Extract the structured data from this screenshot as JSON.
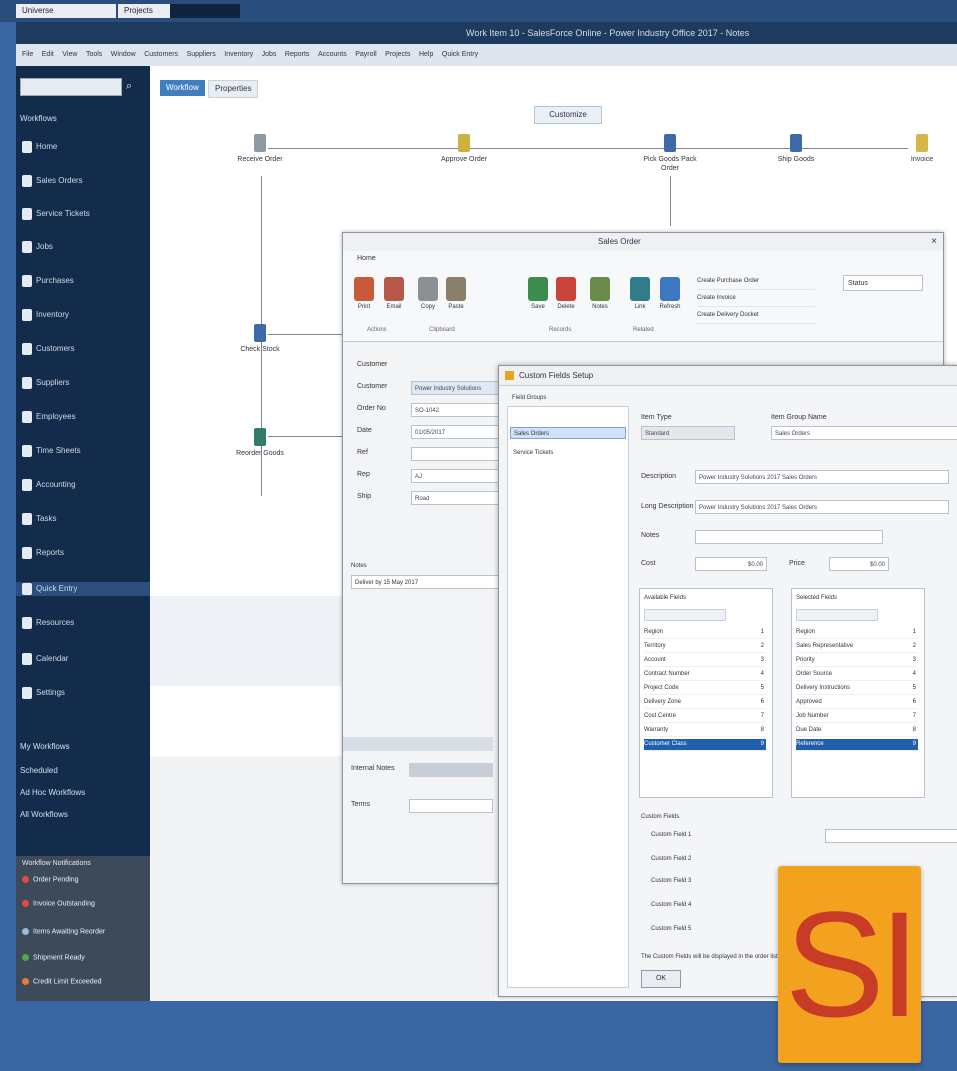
{
  "taskbar": {
    "tabs": [
      "Universe",
      "Projects"
    ]
  },
  "window": {
    "title": "Work Item 10 - SalesForce Online - Power Industry Office 2017 - Notes"
  },
  "menu": [
    "File",
    "Edit",
    "View",
    "Tools",
    "Window",
    "Customers",
    "Suppliers",
    "Inventory",
    "Jobs",
    "Reports",
    "Accounts",
    "Payroll",
    "Projects",
    "Help",
    "Quick Entry"
  ],
  "sidebar": {
    "section": "Workflows",
    "items": [
      "Home",
      "Sales Orders",
      "Service Tickets",
      "Jobs",
      "Purchases",
      "Inventory",
      "Customers",
      "Suppliers",
      "Employees",
      "Time Sheets",
      "Accounting",
      "Tasks",
      "Reports",
      "Quick Entry",
      "Resources",
      "Calendar",
      "Settings"
    ],
    "groups": [
      "My Workflows",
      "Scheduled",
      "Ad Hoc Workflows",
      "All Workflows"
    ],
    "panel2": {
      "header": "Workflow Notifications",
      "items": [
        {
          "label": "Order Pending",
          "color": "#e24a3b"
        },
        {
          "label": "Invoice Outstanding",
          "color": "#e24a3b"
        },
        {
          "label": "Items Awaiting Reorder",
          "color": "#9fb9d6"
        },
        {
          "label": "Shipment Ready",
          "color": "#53a84a"
        },
        {
          "label": "Credit Limit Exceeded",
          "color": "#e27d3b"
        }
      ]
    }
  },
  "main": {
    "tabs": [
      "Workflow",
      "Properties"
    ],
    "center_button": "Customize",
    "nodes": [
      {
        "label": "Receive Order",
        "color": "#8e98a3"
      },
      {
        "label": "Approve Order",
        "color": "#c9b23e"
      },
      {
        "label": "Pick Goods Pack Order",
        "color": "#3e6aa8"
      },
      {
        "label": "Ship Goods",
        "color": "#3e6aa8"
      },
      {
        "label": "Invoice",
        "color": "#d4b64a"
      },
      {
        "label": "Check Stock",
        "color": "#3e6aa8"
      },
      {
        "label": "Reorder Goods",
        "color": "#2f7d6a"
      }
    ]
  },
  "win1": {
    "title": "Sales Order",
    "ribbon_tab": "Home",
    "buttons": [
      {
        "label": "Print",
        "color": "#c65a3a"
      },
      {
        "label": "Email",
        "color": "#b7574a"
      },
      {
        "label": "Copy",
        "color": "#8c8f93"
      },
      {
        "label": "Paste",
        "color": "#8a7f6a"
      },
      {
        "label": "Save",
        "color": "#3a8c4f"
      },
      {
        "label": "Delete",
        "color": "#c9443a"
      },
      {
        "label": "Notes",
        "color": "#6a8c4a"
      },
      {
        "label": "Link",
        "color": "#2f7d8a"
      },
      {
        "label": "Refresh",
        "color": "#3e78c2"
      }
    ],
    "groups": [
      "Actions",
      "Clipboard",
      "Records",
      "Related"
    ],
    "list_items": [
      "Create Purchase Order",
      "Create Invoice",
      "Create Delivery Docket"
    ],
    "dropdown": "Status",
    "form_header": "Customer",
    "form": [
      {
        "label": "Customer",
        "value": "Power Industry Solutions"
      },
      {
        "label": "Order No",
        "value": "SO-1042"
      },
      {
        "label": "Date",
        "value": "01/05/2017"
      },
      {
        "label": "Ref",
        "value": ""
      },
      {
        "label": "Rep",
        "value": "AJ"
      },
      {
        "label": "Ship",
        "value": "Road"
      }
    ],
    "bottom_label": "Notes",
    "bottom_value": "Deliver by 15 May 2017",
    "low_label1": "Internal Notes",
    "low_label2": "Terms"
  },
  "win2": {
    "title": "Custom Fields Setup",
    "left_header": "Field Groups",
    "left_items": [
      "Sales Orders",
      "Service Tickets"
    ],
    "item_type_label": "Item Type",
    "item_type_value": "Standard",
    "item_group_label": "Item Group Name",
    "item_group_value": "Sales Orders",
    "description_label": "Description",
    "description_value": "Power Industry Solutions 2017 Sales Orders",
    "long_desc_label": "Long Description",
    "long_desc_value": "Power Industry Solutions 2017 Sales Orders",
    "notes_label": "Notes",
    "cost_label": "Cost",
    "cost_value": "$0.00",
    "price_label": "Price",
    "price_value": "$0.00",
    "list1": {
      "header": "Available Fields",
      "rows": [
        {
          "name": "Region",
          "n": "1"
        },
        {
          "name": "Territory",
          "n": "2"
        },
        {
          "name": "Account",
          "n": "3"
        },
        {
          "name": "Contract Number",
          "n": "4"
        },
        {
          "name": "Project Code",
          "n": "5"
        },
        {
          "name": "Delivery Zone",
          "n": "6"
        },
        {
          "name": "Cost Centre",
          "n": "7"
        },
        {
          "name": "Warranty",
          "n": "8"
        },
        {
          "name": "Customer Class",
          "n": "9"
        }
      ]
    },
    "list2": {
      "header": "Selected Fields",
      "rows": [
        {
          "name": "Region",
          "n": "1"
        },
        {
          "name": "Sales Representative",
          "n": "2"
        },
        {
          "name": "Priority",
          "n": "3"
        },
        {
          "name": "Order Source",
          "n": "4"
        },
        {
          "name": "Delivery Instructions",
          "n": "5"
        },
        {
          "name": "Approved",
          "n": "6"
        },
        {
          "name": "Job Number",
          "n": "7"
        },
        {
          "name": "Due Date",
          "n": "8"
        },
        {
          "name": "Reference",
          "n": "9"
        }
      ]
    },
    "custom_header": "Custom Fields",
    "custom_rows": [
      "Custom Field 1",
      "Custom Field 2",
      "Custom Field 3",
      "Custom Field 4",
      "Custom Field 5"
    ],
    "note": "The Custom Fields will be displayed in the order listed",
    "ok": "OK"
  },
  "logo": {
    "text": "SI",
    "bg": "#f2a21f",
    "fg": "#c83c27"
  }
}
